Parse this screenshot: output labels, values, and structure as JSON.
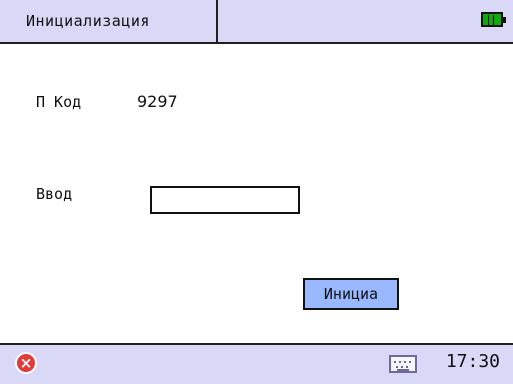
{
  "header": {
    "title": "Инициализация",
    "battery_icon": "battery-icon"
  },
  "form": {
    "code_label": "П Код",
    "code_value": "9297",
    "input_label": "Ввод",
    "input_value": "",
    "init_button_label": "Инициа"
  },
  "footer": {
    "close_icon": "close-icon",
    "keyboard_icon": "keyboard-icon",
    "time": "17:30"
  },
  "colors": {
    "header_bg": "#d9d9f7",
    "footer_bg": "#d9d9f7",
    "button_bg": "#99b8ff",
    "battery": "#0fa80f",
    "close": "#e03b3b"
  }
}
